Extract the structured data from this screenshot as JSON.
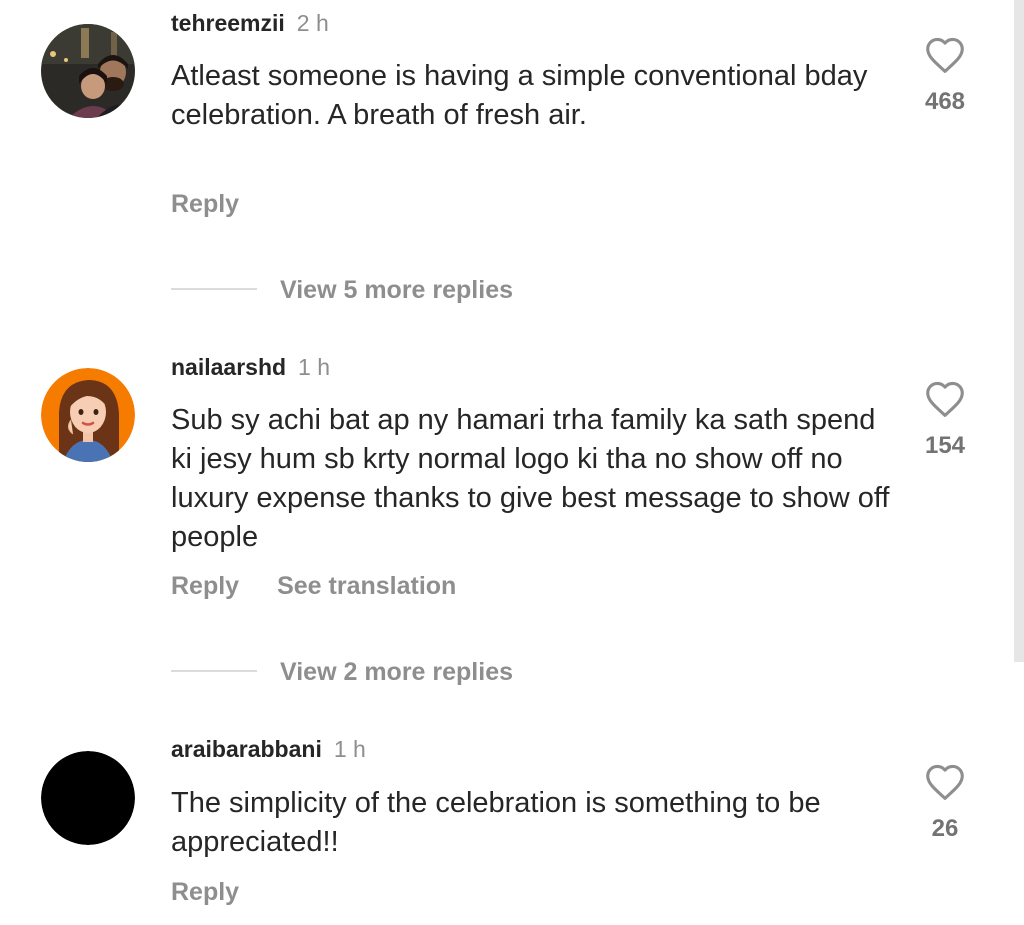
{
  "comments": [
    {
      "username": "tehreemzii",
      "time": "2 h",
      "text": "Atleast someone is having a simple conventional bday celebration.  A breath of fresh air.",
      "likes": "468",
      "reply_label": "Reply",
      "avatar": "couple-photo-avatar"
    },
    {
      "username": "nailaarshd",
      "time": "1 h",
      "text": "Sub sy achi bat ap ny hamari trha  family ka sath spend ki jesy hum sb krty normal logo ki tha no show off no luxury expense thanks to give best message to show off people",
      "likes": "154",
      "reply_label": "Reply",
      "translation_label": "See translation",
      "avatar": "cartoon-girl-avatar",
      "avatar_bg": "#f57c00"
    },
    {
      "username": "araibarabbani",
      "time": "1 h",
      "text": "The simplicity of the celebration is something to be appreciated!!",
      "likes": "26",
      "reply_label": "Reply",
      "avatar": "black-avatar"
    }
  ],
  "view_replies": [
    {
      "label": "View 5 more replies"
    },
    {
      "label": "View 2 more replies"
    }
  ],
  "colors": {
    "text": "#262626",
    "secondary": "#8e8e8e",
    "like_count": "#737373",
    "divider": "#dbdbdb"
  }
}
